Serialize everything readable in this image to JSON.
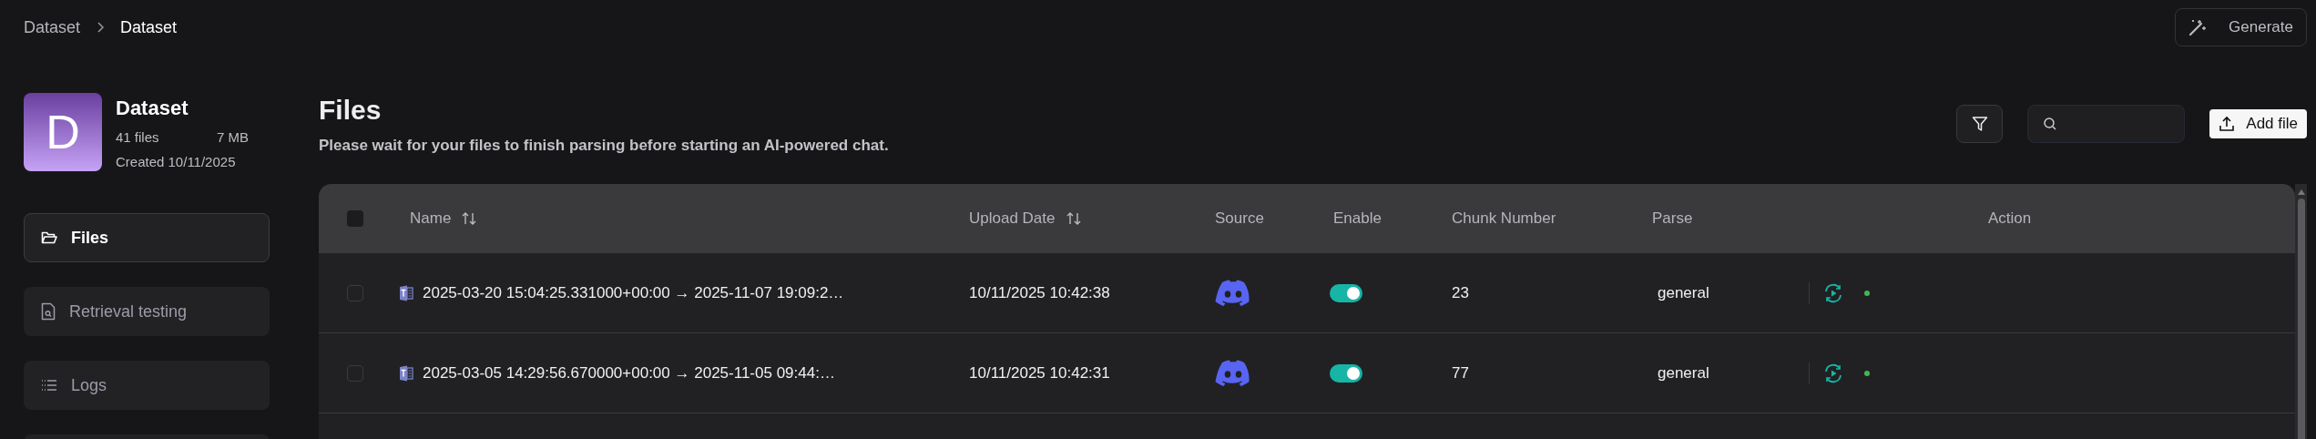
{
  "breadcrumb": [
    "Dataset",
    "Dataset"
  ],
  "generate_button": "Generate",
  "dataset": {
    "initial": "D",
    "name": "Dataset",
    "files": "41 files",
    "size": "7 MB",
    "created": "Created 10/11/2025"
  },
  "nav": [
    {
      "label": "Files",
      "kind": "folder",
      "selected": true
    },
    {
      "label": "Retrieval testing",
      "kind": "search-doc",
      "selected": false
    },
    {
      "label": "Logs",
      "kind": "list",
      "selected": false
    }
  ],
  "header": {
    "title": "Files",
    "subtitle": "Please wait for your files to finish parsing before starting an AI-powered chat."
  },
  "add_file_button": "Add file",
  "table": {
    "all_checked": false,
    "columns": [
      {
        "label": "Name",
        "sortable": true
      },
      {
        "label": "Upload Date",
        "sortable": true
      },
      {
        "label": "Source",
        "sortable": false
      },
      {
        "label": "Enable",
        "sortable": false
      },
      {
        "label": "Chunk Number",
        "sortable": false
      },
      {
        "label": "Parse",
        "sortable": false
      },
      {
        "label": "Action",
        "sortable": false
      }
    ],
    "rows": [
      {
        "checked": false,
        "name": "2025-03-20 15:04:25.331000+00:00 → 2025-11-07 19:09:2…",
        "upload_date": "10/11/2025 10:42:38",
        "kind": "discord",
        "enabled": true,
        "chunk_number": "23",
        "parse": "general",
        "color": "#3fb950"
      },
      {
        "checked": false,
        "name": "2025-03-05 14:29:56.670000+00:00 → 2025-11-05 09:44:…",
        "upload_date": "10/11/2025 10:42:31",
        "kind": "discord",
        "enabled": true,
        "chunk_number": "77",
        "parse": "general",
        "color": "#3fb950"
      }
    ]
  }
}
